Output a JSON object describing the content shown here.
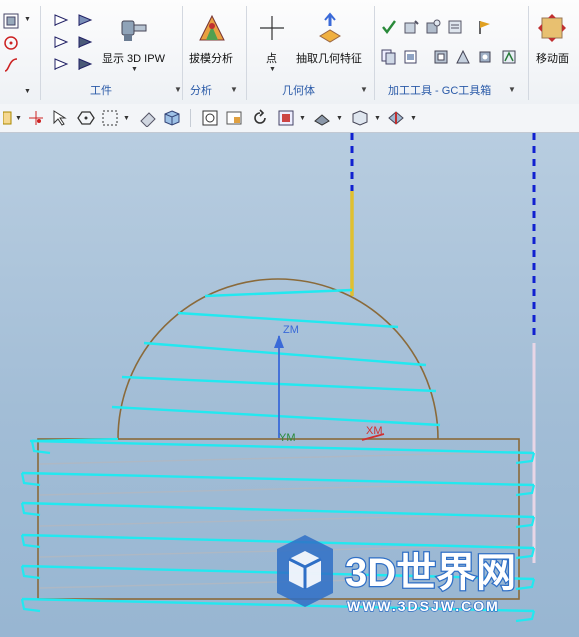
{
  "ribbon": {
    "groups": {
      "workpiece": {
        "label": "工件",
        "ipw_label": "显示 3D IPW"
      },
      "analysis": {
        "label": "分析",
        "draft_label": "拔模分析"
      },
      "geometry": {
        "label": "几何体",
        "point_label": "点",
        "extract_label": "抽取几何特征"
      },
      "tools": {
        "label": "加工工具 - GC工具箱"
      },
      "move": {
        "move_label": "移动面"
      }
    }
  },
  "viewport": {
    "axis_labels": {
      "zm": "ZM",
      "ym": "YM",
      "xm": "XM"
    }
  },
  "watermark": {
    "brand": "3D世界网",
    "url": "WWW.3DSJW.COM"
  },
  "colors": {
    "toolpath": "#22e8f0",
    "part_outline": "#8a6a3a",
    "approach": "#e0c030",
    "axis_blue": "#3a6ad8",
    "axis_red": "#d03030",
    "dash_blue": "#1020d0"
  }
}
